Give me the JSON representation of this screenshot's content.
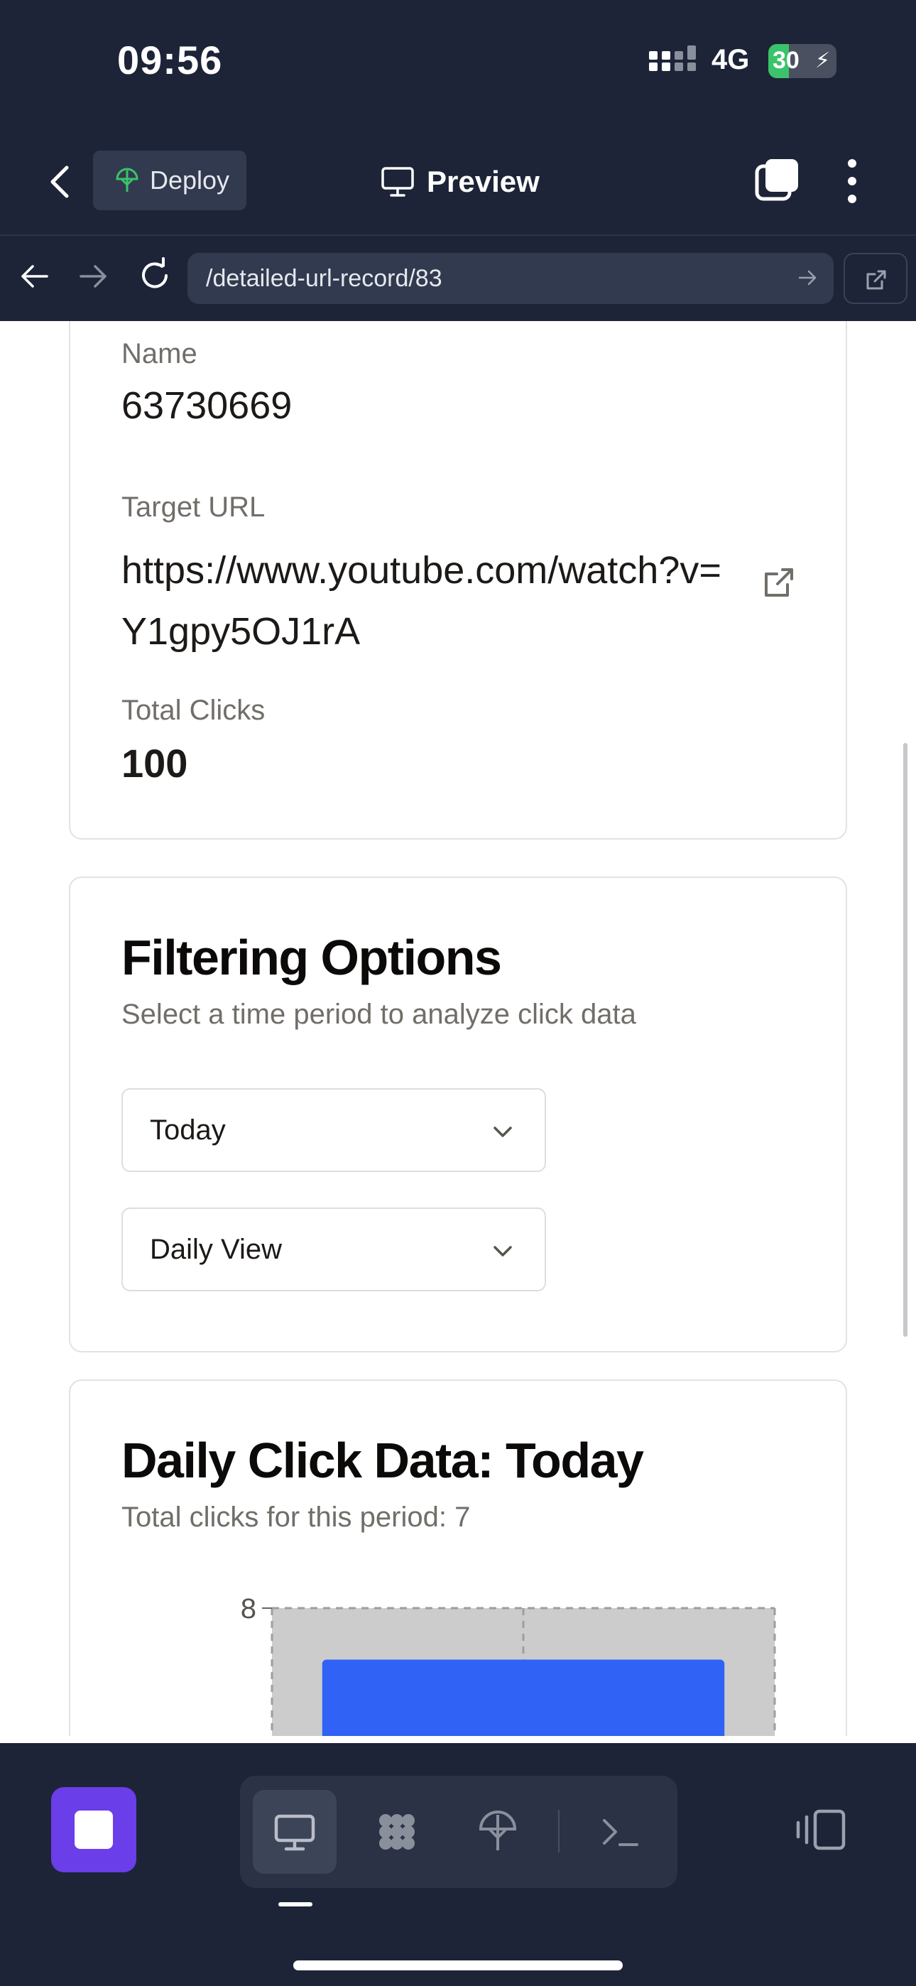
{
  "status_bar": {
    "time": "09:56",
    "network": "4G",
    "battery": "30",
    "battery_level": 0.3
  },
  "header": {
    "deploy_label": "Deploy",
    "preview_label": "Preview"
  },
  "browser": {
    "url": "/detailed-url-record/83"
  },
  "details": {
    "name_label": "Name",
    "name_value": "63730669",
    "target_label": "Target URL",
    "target_value": "https://www.youtube.com/watch?v=Y1gpy5OJ1rA",
    "clicks_label": "Total Clicks",
    "clicks_value": "100"
  },
  "filter": {
    "title": "Filtering Options",
    "subtitle": "Select a time period to analyze click data",
    "period_selected": "Today",
    "view_selected": "Daily View"
  },
  "chart_section": {
    "title": "Daily Click Data: Today",
    "subtitle": "Total clicks for this period: 7"
  },
  "chart_data": {
    "type": "bar",
    "categories": [
      ""
    ],
    "values": [
      7
    ],
    "ylim": [
      0,
      8
    ],
    "yticks": [
      "8"
    ],
    "grid": true,
    "bar_color": "#2f62f5",
    "plot_bg": "#cccccc"
  },
  "colors": {
    "header_bg": "#1d2438",
    "accent_purple": "#6a3ee8"
  },
  "icons": {
    "back": "chevron-left-icon",
    "deploy": "deploy-icon",
    "preview": "monitor-icon",
    "tabs": "tabs-icon",
    "more": "more-vertical-icon",
    "external": "external-link-icon",
    "terminal": "terminal-icon"
  }
}
